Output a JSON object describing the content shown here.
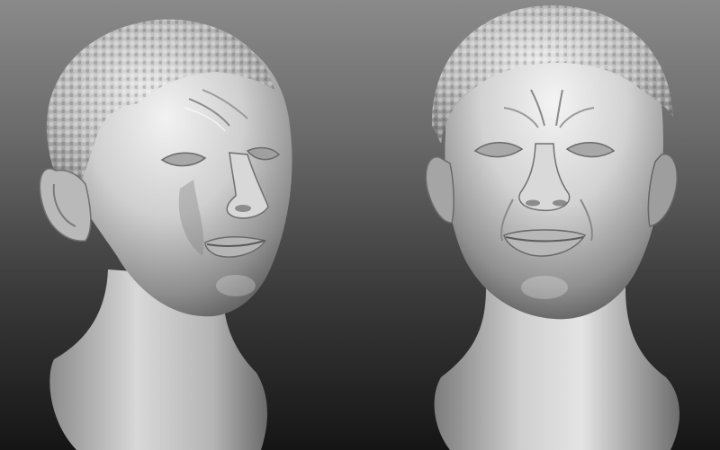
{
  "scene": {
    "background_top": "#8a8a8a",
    "background_bottom": "#151515",
    "material_color": "#d6d6d6",
    "objects": [
      {
        "name": "sculpted-head",
        "view": "three-quarter"
      },
      {
        "name": "sculpted-head",
        "view": "front"
      }
    ]
  }
}
